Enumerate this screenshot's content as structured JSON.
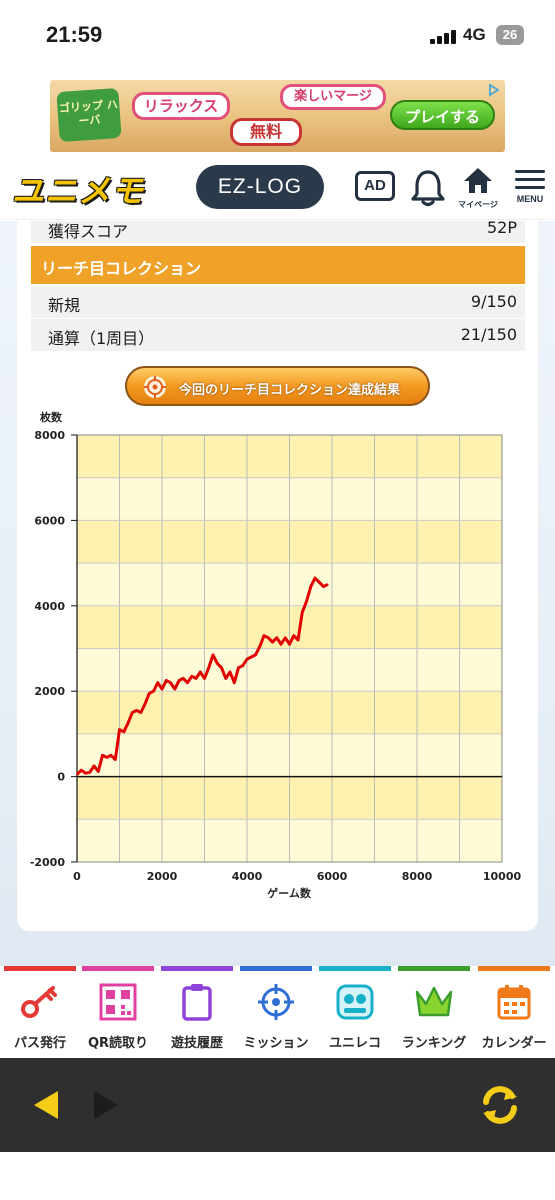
{
  "status_bar": {
    "time": "21:59",
    "network": "4G",
    "battery": "26"
  },
  "ad_banner": {
    "logo_text": "ゴリップ ハーバ",
    "pill_1": "リラックス",
    "pill_2": "楽しいマージ",
    "pill_3": "無料",
    "cta": "プレイする"
  },
  "header": {
    "logo": "ユニメモ",
    "ezlog": "EZ-LOG",
    "ad_label": "AD",
    "mypage_label": "マイページ",
    "menu_label": "MENU"
  },
  "score_row": {
    "label": "獲得スコア",
    "value": "52P"
  },
  "section_title": "リーチ目コレクション",
  "new_row": {
    "label": "新規",
    "value": "9/150"
  },
  "total_row": {
    "label": "通算（1周目）",
    "value": "21/150"
  },
  "result_button": "今回のリーチ目コレクション達成結果",
  "chart_data": {
    "type": "line",
    "ylabel": "枚数",
    "xlabel": "ゲーム数",
    "xlim": [
      0,
      10000
    ],
    "ylim": [
      -2000,
      8000
    ],
    "x_ticks": [
      "0",
      "2000",
      "4000",
      "6000",
      "8000",
      "10000"
    ],
    "y_ticks": [
      "8000",
      "6000",
      "4000",
      "2000",
      "0",
      "-2000"
    ],
    "series": [
      {
        "color": "#e00000",
        "x": [
          0,
          100,
          200,
          300,
          400,
          500,
          600,
          700,
          800,
          900,
          1000,
          1100,
          1200,
          1300,
          1400,
          1500,
          1600,
          1700,
          1800,
          1900,
          2000,
          2100,
          2200,
          2300,
          2400,
          2500,
          2600,
          2700,
          2800,
          2900,
          3000,
          3100,
          3200,
          3300,
          3400,
          3500,
          3600,
          3700,
          3800,
          3900,
          4000,
          4100,
          4200,
          4300,
          4400,
          4500,
          4600,
          4700,
          4800,
          4900,
          5000,
          5100,
          5200,
          5300,
          5400,
          5500,
          5600,
          5700,
          5800,
          5900
        ],
        "values": [
          50,
          150,
          80,
          100,
          250,
          120,
          500,
          450,
          500,
          400,
          1100,
          1050,
          1250,
          1500,
          1550,
          1500,
          1700,
          1950,
          2000,
          2200,
          2050,
          2250,
          2200,
          2050,
          2250,
          2300,
          2200,
          2350,
          2300,
          2450,
          2300,
          2550,
          2850,
          2650,
          2550,
          2300,
          2450,
          2200,
          2550,
          2600,
          2750,
          2800,
          2850,
          3050,
          3300,
          3250,
          3150,
          3250,
          3100,
          3250,
          3100,
          3300,
          3200,
          3850,
          4100,
          4450,
          4650,
          4550,
          4450,
          4500
        ]
      }
    ]
  },
  "tabs": [
    {
      "label": "パス発行",
      "color": "#e53935"
    },
    {
      "label": "QR読取り",
      "color": "#e040a0"
    },
    {
      "label": "遊技履歴",
      "color": "#8e44d8"
    },
    {
      "label": "ミッション",
      "color": "#2f6fd6"
    },
    {
      "label": "ユニレコ",
      "color": "#18b0c8"
    },
    {
      "label": "ランキング",
      "color": "#3a9e2e"
    },
    {
      "label": "カレンダー",
      "color": "#f07a1a"
    }
  ]
}
